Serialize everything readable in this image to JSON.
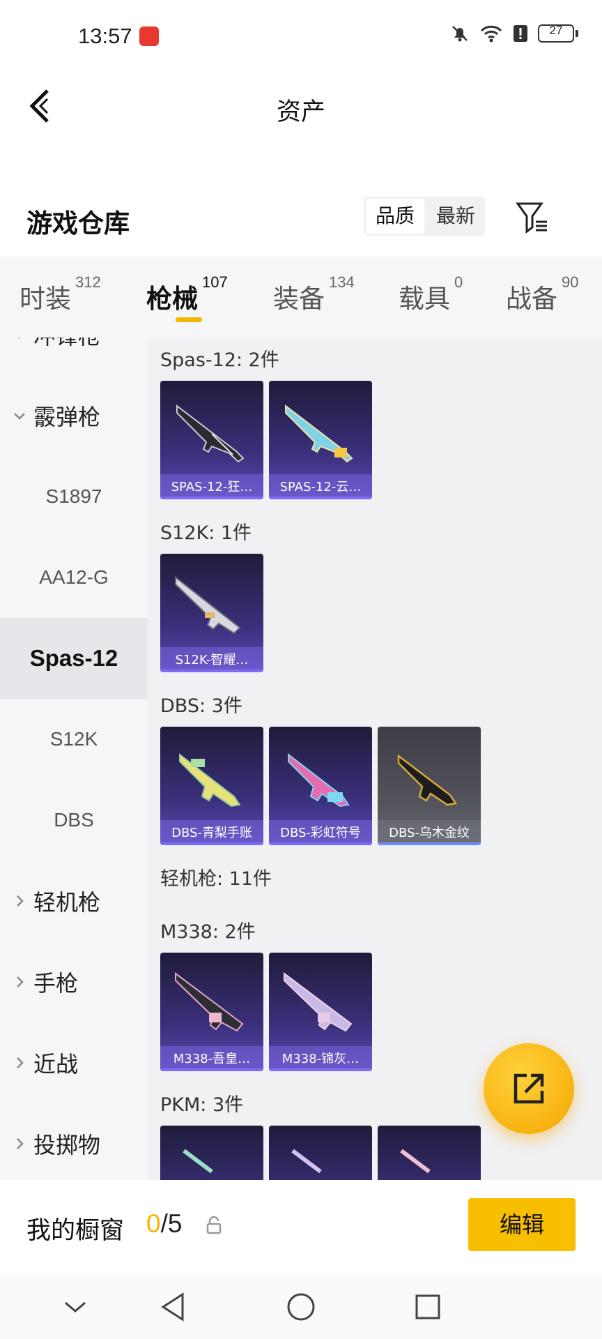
{
  "status": {
    "time": "13:57",
    "battery": "27",
    "icons": [
      "app-notification-icon",
      "mute-icon",
      "wifi-icon",
      "alert-icon",
      "battery-icon"
    ]
  },
  "nav": {
    "title": "资产",
    "back_icon": "back-arrow-icon"
  },
  "warehouse": {
    "title": "游戏仓库",
    "sort_options": [
      "品质",
      "最新"
    ],
    "sort_selected": "品质",
    "filter_icon": "filter-icon"
  },
  "tabs": [
    {
      "label": "时装",
      "count": "312"
    },
    {
      "label": "枪械",
      "count": "107",
      "active": true
    },
    {
      "label": "装备",
      "count": "134"
    },
    {
      "label": "载具",
      "count": "0"
    },
    {
      "label": "战备",
      "count": "90"
    }
  ],
  "sidebar": {
    "items": [
      {
        "label": "冲锋枪",
        "type": "parent",
        "expanded": true
      },
      {
        "label": "霰弹枪",
        "type": "parent",
        "expanded": true
      },
      {
        "label": "S1897",
        "type": "child"
      },
      {
        "label": "AA12-G",
        "type": "child"
      },
      {
        "label": "Spas-12",
        "type": "child",
        "active": true
      },
      {
        "label": "S12K",
        "type": "child"
      },
      {
        "label": "DBS",
        "type": "child"
      },
      {
        "label": "轻机枪",
        "type": "parent",
        "expanded": false
      },
      {
        "label": "手枪",
        "type": "parent",
        "expanded": false
      },
      {
        "label": "近战",
        "type": "parent",
        "expanded": false
      },
      {
        "label": "投掷物",
        "type": "parent",
        "expanded": false
      }
    ]
  },
  "groups": [
    {
      "label": "Spas-12: 2件",
      "items": [
        {
          "name": "SPAS-12-狂…",
          "style": "purple"
        },
        {
          "name": "SPAS-12-云…",
          "style": "purple"
        }
      ]
    },
    {
      "label": "S12K: 1件",
      "items": [
        {
          "name": "S12K-智耀…",
          "style": "purple"
        }
      ]
    },
    {
      "label": "DBS: 3件",
      "items": [
        {
          "name": "DBS-青梨手账",
          "style": "purple"
        },
        {
          "name": "DBS-彩虹符号",
          "style": "purple"
        },
        {
          "name": "DBS-乌木金纹",
          "style": "grey"
        }
      ]
    },
    {
      "label": "轻机枪: 11件",
      "items": []
    },
    {
      "label": "M338: 2件",
      "items": [
        {
          "name": "M338-吾皇…",
          "style": "purple"
        },
        {
          "name": "M338-锦灰…",
          "style": "purple"
        }
      ]
    },
    {
      "label": "PKM: 3件",
      "items": [
        {
          "name": "",
          "style": "purple"
        },
        {
          "name": "",
          "style": "purple"
        },
        {
          "name": "",
          "style": "purple"
        }
      ]
    }
  ],
  "fab_icon": "share-export-icon",
  "showcase": {
    "title": "我的橱窗",
    "current": "0",
    "total": "/5",
    "edit_label": "编辑"
  },
  "system_nav": [
    "collapse-icon",
    "back-triangle-icon",
    "home-circle-icon",
    "recents-square-icon"
  ]
}
